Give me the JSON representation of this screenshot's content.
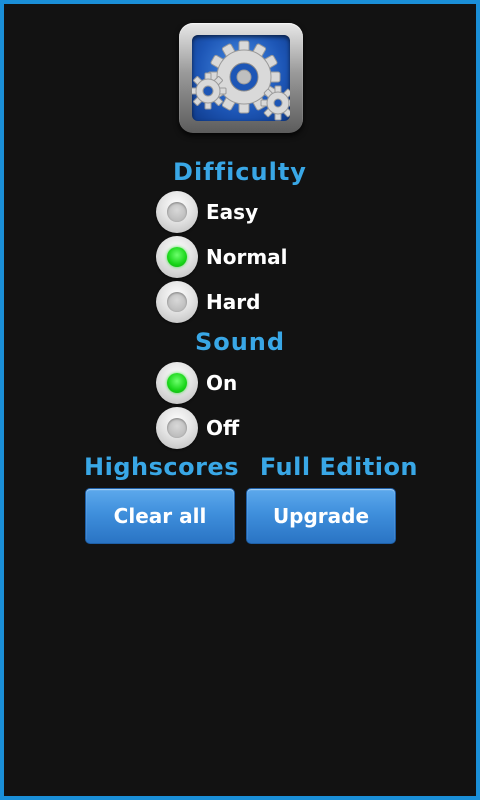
{
  "difficulty": {
    "title": "Difficulty",
    "options": [
      {
        "label": "Easy",
        "selected": false
      },
      {
        "label": "Normal",
        "selected": true
      },
      {
        "label": "Hard",
        "selected": false
      }
    ]
  },
  "sound": {
    "title": "Sound",
    "options": [
      {
        "label": "On",
        "selected": true
      },
      {
        "label": "Off",
        "selected": false
      }
    ]
  },
  "highscores": {
    "title": "Highscores",
    "clear_label": "Clear all"
  },
  "full_edition": {
    "title": "Full Edition",
    "upgrade_label": "Upgrade"
  },
  "icons": {
    "app": "settings-gear-icon"
  },
  "colors": {
    "accent": "#39a7e6",
    "frame": "#1a8fd8",
    "background": "#121212",
    "radio_selected": "#18d518",
    "button": "#3f8fdc"
  }
}
